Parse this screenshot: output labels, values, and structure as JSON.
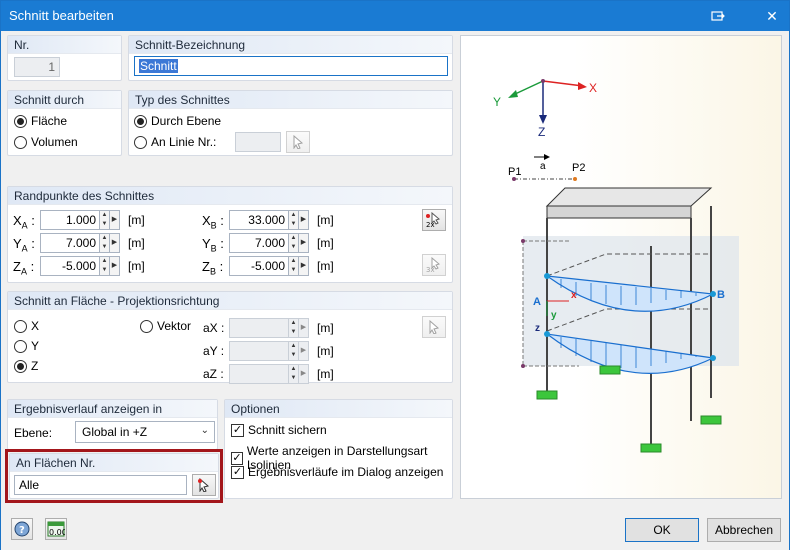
{
  "window": {
    "title": "Schnitt bearbeiten"
  },
  "nr": {
    "label": "Nr.",
    "value": "1"
  },
  "bezeichnung": {
    "label": "Schnitt-Bezeichnung",
    "value": "Schnitt"
  },
  "schnitt_durch": {
    "label": "Schnitt durch",
    "flaeche": "Fläche",
    "volumen": "Volumen"
  },
  "typ": {
    "label": "Typ des Schnittes",
    "durch_ebene": "Durch Ebene",
    "an_linie": "An Linie Nr.:"
  },
  "randpunkte": {
    "label": "Randpunkte des Schnittes",
    "unit": "[m]",
    "XA": "1.000",
    "YA": "7.000",
    "ZA": "-5.000",
    "XB": "33.000",
    "YB": "7.000",
    "ZB": "-5.000"
  },
  "projektion": {
    "label": "Schnitt an Fläche - Projektionsrichtung",
    "x": "X",
    "y": "Y",
    "z": "Z",
    "vektor": "Vektor",
    "ax": "aX :",
    "ay": "aY :",
    "az": "aZ :",
    "unit": "[m]"
  },
  "ergebnis": {
    "label": "Ergebnisverlauf anzeigen in",
    "ebene_label": "Ebene:",
    "ebene_value": "Global in +Z"
  },
  "optionen": {
    "label": "Optionen",
    "schnitt_sichern": "Schnitt sichern",
    "werte_anzeigen": "Werte anzeigen in Darstellungsart Isolinien",
    "ergebnisverlaeufe": "Ergebnisverläufe im Dialog anzeigen"
  },
  "flaechen": {
    "label": "An Flächen Nr.",
    "value": "Alle"
  },
  "footer": {
    "ok": "OK",
    "abbrechen": "Abbrechen"
  },
  "diagram": {
    "axis_x": "X",
    "axis_y": "Y",
    "axis_z": "Z",
    "p1": "P1",
    "p2": "P2",
    "a": "a",
    "point_a": "A",
    "point_b": "B",
    "local_x": "x",
    "local_y": "y",
    "local_z": "z"
  },
  "colors": {
    "titlebar": "#1a7bd3",
    "highlight_frame": "#a3161b",
    "diagram_blue": "#1a6fcf",
    "support_green": "#3cc63c"
  }
}
